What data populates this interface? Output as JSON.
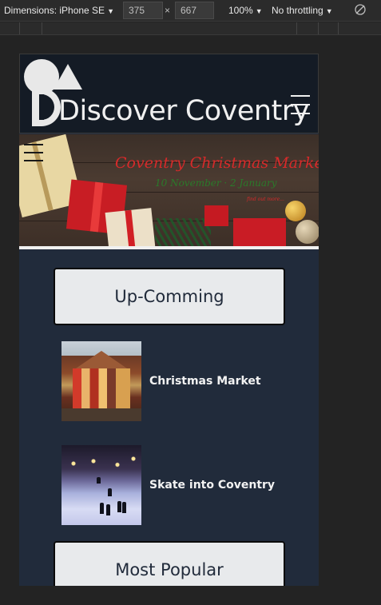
{
  "devtools": {
    "dimensions_label": "Dimensions: iPhone SE",
    "width": "375",
    "times": "×",
    "height": "667",
    "zoom": "100%",
    "throttling": "No throttling"
  },
  "site": {
    "brand": "Discover Coventry",
    "banner": {
      "title": "Coventry Christmas Market",
      "dates": "10 November · 2 January",
      "tagline": "find out more..."
    },
    "sections": [
      {
        "label": "Up-Comming"
      },
      {
        "label": "Most Popular"
      }
    ],
    "events": [
      {
        "label": "Christmas Market"
      },
      {
        "label": "Skate into Coventry"
      }
    ]
  },
  "colors": {
    "page_bg": "#212b3b",
    "header_bg": "#141b25",
    "button_bg": "#e8eaec",
    "text_light": "#f2f2f2"
  }
}
